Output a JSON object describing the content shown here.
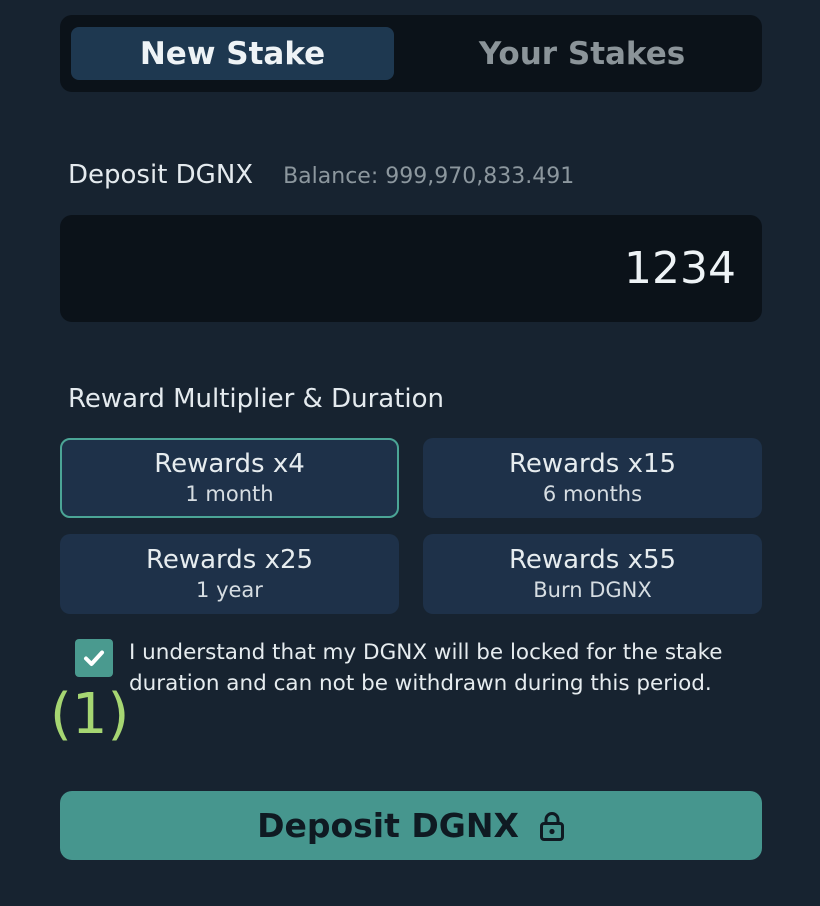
{
  "tabs": {
    "new_stake": "New Stake",
    "your_stakes": "Your Stakes"
  },
  "deposit": {
    "label": "Deposit DGNX",
    "balance": "Balance: 999,970,833.491",
    "amount": "1234"
  },
  "multiplier": {
    "label": "Reward Multiplier & Duration",
    "options": [
      {
        "title": "Rewards x4",
        "sub": "1 month",
        "selected": true
      },
      {
        "title": "Rewards x15",
        "sub": "6 months",
        "selected": false
      },
      {
        "title": "Rewards x25",
        "sub": "1 year",
        "selected": false
      },
      {
        "title": "Rewards x55",
        "sub": "Burn DGNX",
        "selected": false
      }
    ]
  },
  "consent": {
    "checked": true,
    "text": "I understand that my DGNX will be locked for the stake duration and can not be withdrawn during this period."
  },
  "annotation": "(1)",
  "action": {
    "deposit_label": "Deposit DGNX",
    "icon": "lock-icon"
  },
  "colors": {
    "background": "#172330",
    "panel": "#0b1219",
    "accent": "#46968e",
    "annotation": "#a6d672"
  }
}
